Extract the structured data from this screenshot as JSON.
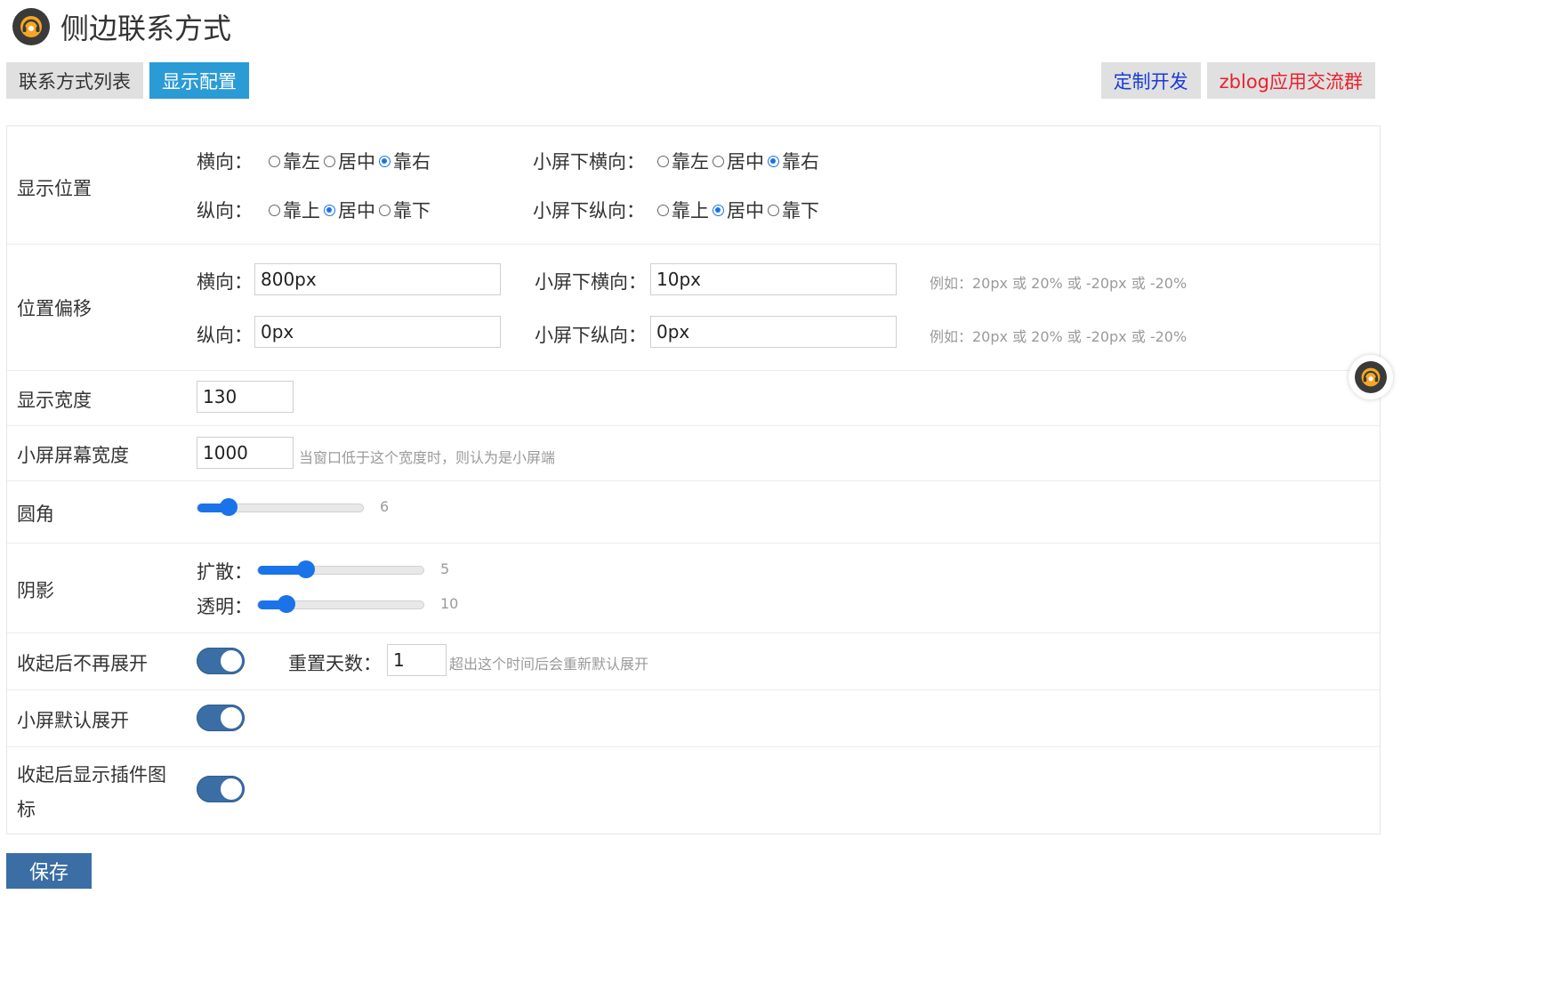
{
  "header": {
    "title": "侧边联系方式",
    "logo_icon": "headset-icon"
  },
  "tabs": [
    {
      "label": "联系方式列表",
      "active": false
    },
    {
      "label": "显示配置",
      "active": true
    }
  ],
  "right_tabs": [
    {
      "label": "定制开发",
      "color": "#1a3bd6"
    },
    {
      "label": "zblog应用交流群",
      "color": "#e8222e"
    }
  ],
  "position": {
    "label": "显示位置",
    "h_label": "横向：",
    "h_options": [
      "靠左",
      "居中",
      "靠右"
    ],
    "h_selected": "靠右",
    "v_label": "纵向：",
    "v_options": [
      "靠上",
      "居中",
      "靠下"
    ],
    "v_selected": "居中",
    "sh_label": "小屏下横向：",
    "sh_options": [
      "靠左",
      "居中",
      "靠右"
    ],
    "sh_selected": "靠右",
    "sv_label": "小屏下纵向：",
    "sv_options": [
      "靠上",
      "居中",
      "靠下"
    ],
    "sv_selected": "居中"
  },
  "offset": {
    "label": "位置偏移",
    "h_label": "横向：",
    "h_value": "800px",
    "v_label": "纵向：",
    "v_value": "0px",
    "sh_label": "小屏下横向：",
    "sh_value": "10px",
    "sv_label": "小屏下纵向：",
    "sv_value": "0px",
    "hint1": "例如：20px 或 20% 或 -20px 或 -20%",
    "hint2": "例如：20px 或 20% 或 -20px 或 -20%"
  },
  "width": {
    "label": "显示宽度",
    "value": "130"
  },
  "small_width": {
    "label": "小屏屏幕宽度",
    "value": "1000",
    "hint": "当窗口低于这个宽度时，则认为是小屏端"
  },
  "radius": {
    "label": "圆角",
    "value": "6",
    "fraction": 0.19
  },
  "shadow": {
    "label": "阴影",
    "spread_label": "扩散：",
    "spread_value": "5",
    "spread_fraction": 0.29,
    "opacity_label": "透明：",
    "opacity_value": "10",
    "opacity_fraction": 0.17
  },
  "collapse": {
    "label": "收起后不再展开",
    "on": true,
    "reset_label": "重置天数：",
    "reset_value": "1",
    "reset_hint": "超出这个时间后会重新默认展开"
  },
  "small_expand": {
    "label": "小屏默认展开",
    "on": true
  },
  "show_icon": {
    "label_line1": "收起后显示插件图",
    "label_line2": "标",
    "on": true
  },
  "save_label": "保存",
  "float_icon": "headset-icon"
}
